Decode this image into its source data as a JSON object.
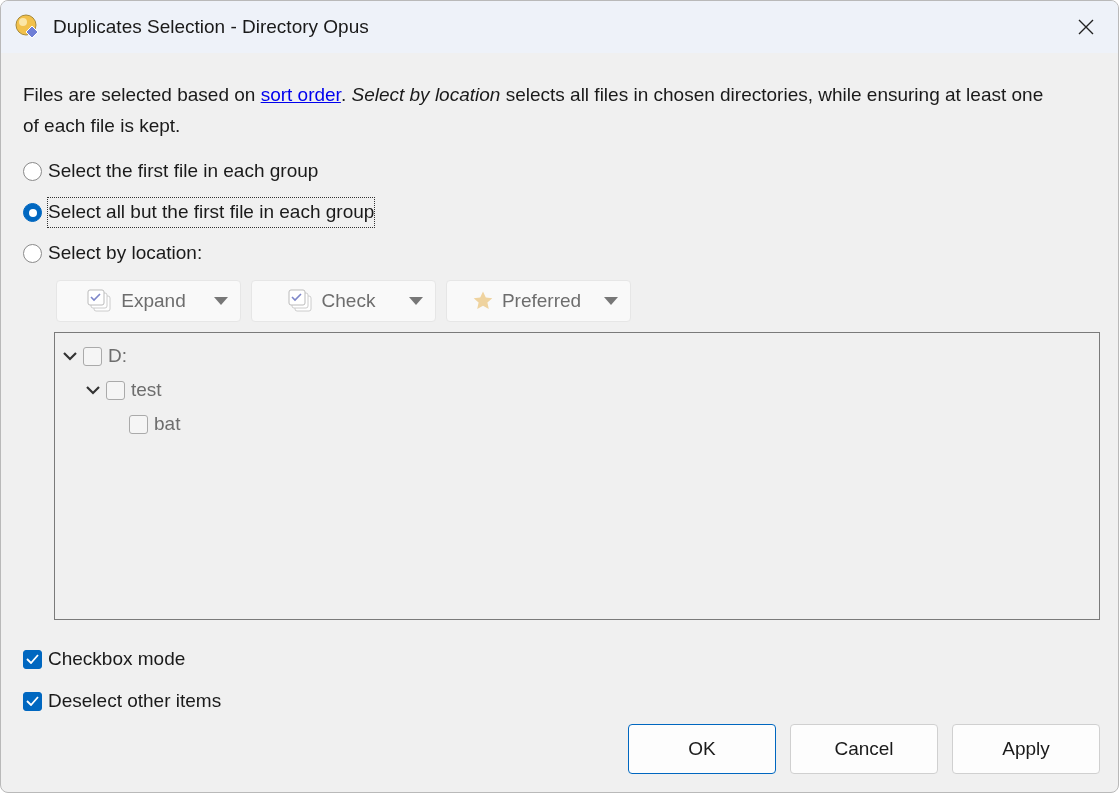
{
  "window": {
    "title": "Duplicates Selection - Directory Opus"
  },
  "intro": {
    "before": "Files are selected based on ",
    "link": "sort order",
    "after": ". *Select by location* selects all files in chosen directories, while ensuring at least one of each file is kept."
  },
  "options": [
    {
      "label": "Select the first file in each group",
      "selected": false,
      "focused": false
    },
    {
      "label": "Select all but the first file in each group",
      "selected": true,
      "focused": true
    },
    {
      "label": "Select by location:",
      "selected": false,
      "focused": false
    }
  ],
  "toolbar": [
    {
      "label": "Expand",
      "kind": "stack",
      "disabled": true
    },
    {
      "label": "Check",
      "kind": "stack",
      "disabled": true
    },
    {
      "label": "Preferred",
      "kind": "star",
      "disabled": true
    }
  ],
  "tree": {
    "disabled": true,
    "items": [
      {
        "label": "D:",
        "checked": false,
        "expanded": true,
        "children": [
          {
            "label": "test",
            "checked": false,
            "expanded": true,
            "children": [
              {
                "label": "bat",
                "checked": false
              }
            ]
          }
        ]
      }
    ]
  },
  "checkboxes": [
    {
      "label": "Checkbox mode",
      "checked": true
    },
    {
      "label": "Deselect other items",
      "checked": true
    }
  ],
  "buttons": [
    {
      "label": "OK",
      "default": true
    },
    {
      "label": "Cancel",
      "default": false
    },
    {
      "label": "Apply",
      "default": false
    }
  ]
}
